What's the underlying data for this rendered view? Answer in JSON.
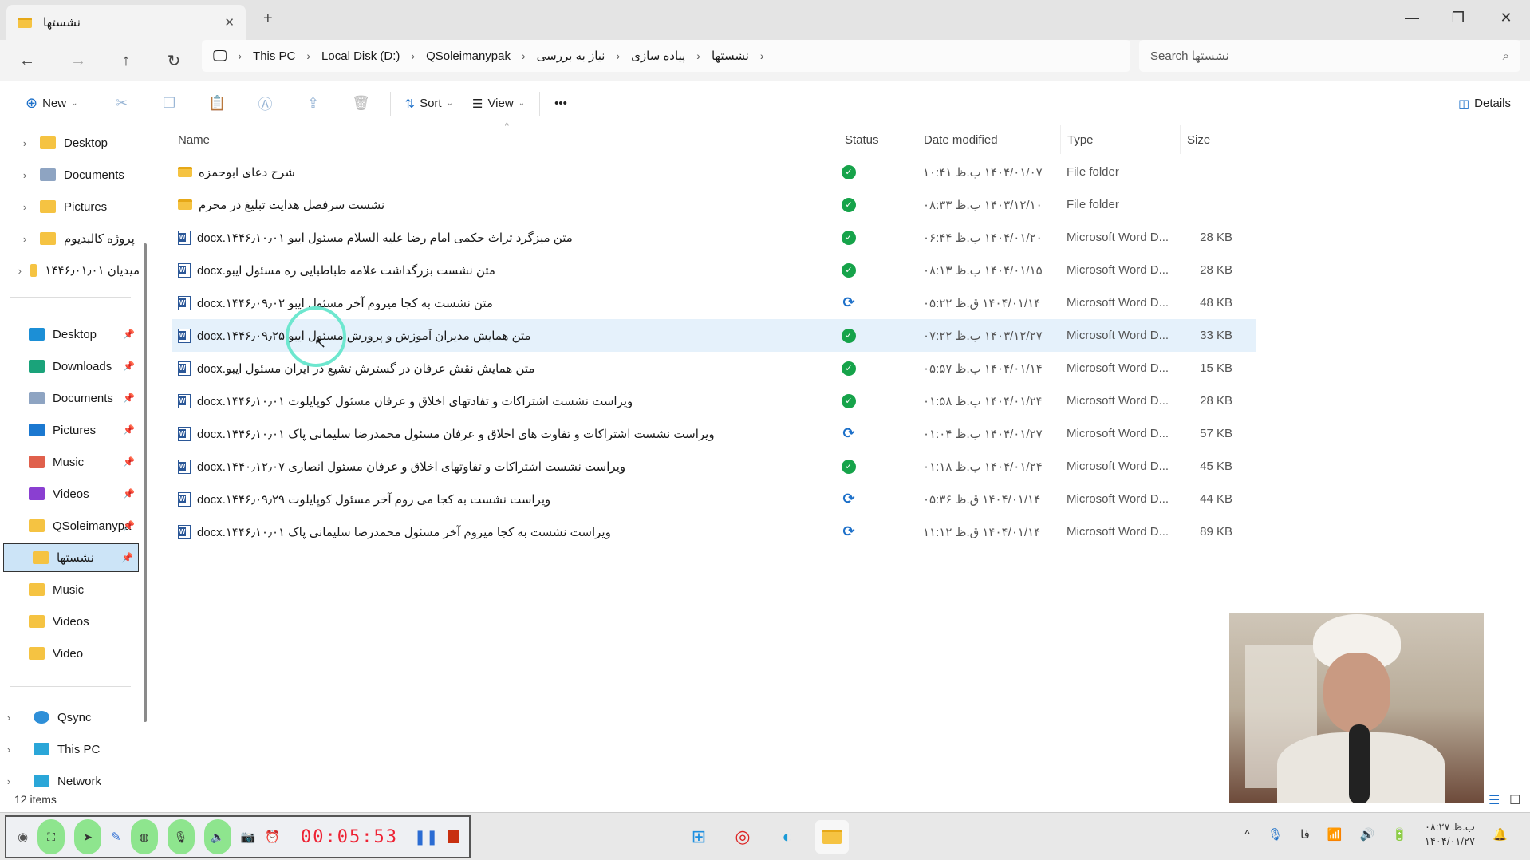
{
  "window": {
    "tab_title": "نشستها",
    "new_tab": "+",
    "close_tab": "✕",
    "minimize": "—",
    "maximize": "❐",
    "close": "✕"
  },
  "breadcrumb": [
    "This PC",
    "Local Disk (D:)",
    "QSoleimanypak",
    "نیاز به بررسی",
    "پیاده سازی",
    "نشستها"
  ],
  "search": {
    "placeholder": "Search نشستها"
  },
  "toolbar": {
    "new": "New",
    "sort": "Sort",
    "view": "View",
    "more": "•••",
    "details": "Details"
  },
  "sidebar": {
    "tree": [
      "Desktop",
      "Documents",
      "Pictures",
      "پروژه کالبدیوم",
      "۱۴۴۶٫۰۱٫۰۱ میدیان"
    ],
    "quick": [
      {
        "label": "Desktop",
        "color": "#1c8fd6"
      },
      {
        "label": "Downloads",
        "color": "#1aa37a"
      },
      {
        "label": "Documents",
        "color": "#8ea4c2"
      },
      {
        "label": "Pictures",
        "color": "#1b78d0"
      },
      {
        "label": "Music",
        "color": "#e0604c"
      },
      {
        "label": "Videos",
        "color": "#8a3fd1"
      },
      {
        "label": "QSoleimanypak",
        "color": "#f5c342"
      },
      {
        "label": "نشستها",
        "color": "#f5c342"
      },
      {
        "label": "Music",
        "color": "#f5c342"
      },
      {
        "label": "Videos",
        "color": "#f5c342"
      },
      {
        "label": "Video",
        "color": "#f5c342"
      }
    ],
    "bottom": [
      "Qsync",
      "This PC",
      "Network"
    ]
  },
  "columns": {
    "name": "Name",
    "status": "Status",
    "date": "Date modified",
    "type": "Type",
    "size": "Size"
  },
  "files": [
    {
      "name": "شرح دعای ابوحمزه",
      "kind": "folder",
      "status": "ok",
      "date": "۱۴۰۴/۰۱/۰۷ ب.ظ ۱۰:۴۱",
      "type": "File folder",
      "size": ""
    },
    {
      "name": "نشست سرفصل هدایت تبلیغ در محرم",
      "kind": "folder",
      "status": "ok",
      "date": "۱۴۰۳/۱۲/۱۰ ب.ظ ۰۸:۳۳",
      "type": "File folder",
      "size": ""
    },
    {
      "name": "متن میزگرد تراث حکمی امام رضا علیه السلام مسئول ایبو ۱۴۴۶٫۱۰٫۰۱.docx",
      "kind": "word",
      "status": "ok",
      "date": "۱۴۰۴/۰۱/۲۰ ب.ظ ۰۶:۴۴",
      "type": "Microsoft Word D...",
      "size": "28 KB"
    },
    {
      "name": "متن نشست بزرگداشت علامه طباطبایی ره مسئول ایبو.docx",
      "kind": "word",
      "status": "ok",
      "date": "۱۴۰۴/۰۱/۱۵ ب.ظ ۰۸:۱۳",
      "type": "Microsoft Word D...",
      "size": "28 KB"
    },
    {
      "name": "متن نشست به کجا میروم آخر مسئول ایبو ۱۴۴۶٫۰۹٫۰۲.docx",
      "kind": "word",
      "status": "sync",
      "date": "۱۴۰۴/۰۱/۱۴ ق.ظ ۰۵:۲۲",
      "type": "Microsoft Word D...",
      "size": "48 KB"
    },
    {
      "name": "متن همایش مدیران آموزش و پرورش مسئول ایبو ۱۴۴۶٫۰۹٫۲۵.docx",
      "kind": "word",
      "status": "ok",
      "date": "۱۴۰۳/۱۲/۲۷ ب.ظ ۰۷:۲۲",
      "type": "Microsoft Word D...",
      "size": "33 KB",
      "selected": true
    },
    {
      "name": "متن همایش نقش عرفان در گسترش تشیع در ایران مسئول ایبو.docx",
      "kind": "word",
      "status": "ok",
      "date": "۱۴۰۴/۰۱/۱۴ ب.ظ ۰۵:۵۷",
      "type": "Microsoft Word D...",
      "size": "15 KB"
    },
    {
      "name": "ویراست نشست اشتراکات و تفادتهای اخلاق و عرفان مسئول کوپایلوت ۱۴۴۶٫۱۰٫۰۱.docx",
      "kind": "word",
      "status": "ok",
      "date": "۱۴۰۴/۰۱/۲۴ ب.ظ ۰۱:۵۸",
      "type": "Microsoft Word D...",
      "size": "28 KB"
    },
    {
      "name": "ویراست نشست اشتراکات و تفاوت های اخلاق و عرفان مسئول محمدرضا سلیمانی پاک ۱۴۴۶٫۱۰٫۰۱.docx",
      "kind": "word",
      "status": "sync",
      "date": "۱۴۰۴/۰۱/۲۷ ب.ظ ۰۱:۰۴",
      "type": "Microsoft Word D...",
      "size": "57 KB"
    },
    {
      "name": "ویراست نشست اشتراکات و تفاوتهای اخلاق و عرفان مسئول انصاری ۱۴۴۰٫۱۲٫۰۷.docx",
      "kind": "word",
      "status": "ok",
      "date": "۱۴۰۴/۰۱/۲۴ ب.ظ ۰۱:۱۸",
      "type": "Microsoft Word D...",
      "size": "45 KB"
    },
    {
      "name": "ویراست نشست به کجا می روم آخر مسئول کوپایلوت ۱۴۴۶٫۰۹٫۲۹.docx",
      "kind": "word",
      "status": "sync",
      "date": "۱۴۰۴/۰۱/۱۴ ق.ظ ۰۵:۳۶",
      "type": "Microsoft Word D...",
      "size": "44 KB"
    },
    {
      "name": "ویراست نشست به کجا میروم آخر مسئول محمدرضا سلیمانی پاک ۱۴۴۶٫۱۰٫۰۱.docx",
      "kind": "word",
      "status": "sync",
      "date": "۱۴۰۴/۰۱/۱۴ ق.ظ ۱۱:۱۲",
      "type": "Microsoft Word D...",
      "size": "89 KB"
    }
  ],
  "status_bar": {
    "items": "12 items"
  },
  "recorder": {
    "timer": "00:05:53"
  },
  "tray": {
    "lang": "فا",
    "time": "ب.ظ ۰۸:۲۷",
    "date": "۱۴۰۴/۰۱/۲۷"
  }
}
